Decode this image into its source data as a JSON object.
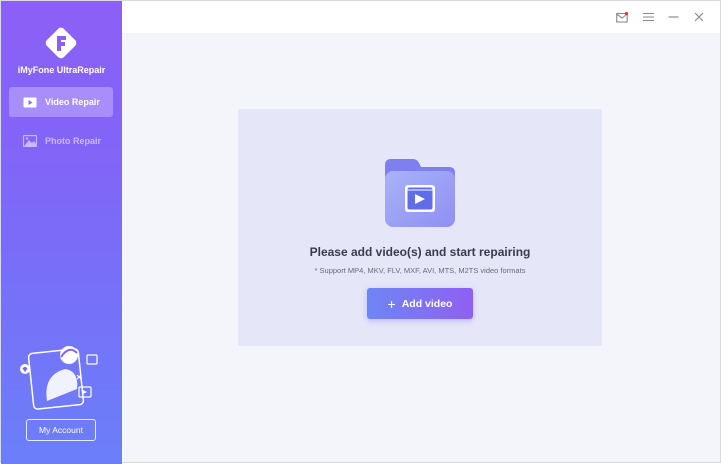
{
  "app": {
    "name": "iMyFone UltraRepair"
  },
  "sidebar": {
    "items": [
      {
        "label": "Video Repair",
        "icon": "video-icon",
        "active": true
      },
      {
        "label": "Photo Repair",
        "icon": "image-icon",
        "active": false
      }
    ],
    "account_label": "My Account"
  },
  "titlebar": {
    "icons": [
      "mail-icon",
      "menu-icon",
      "minimize-icon",
      "close-icon"
    ],
    "notification_color": "#e53935"
  },
  "main": {
    "title": "Please add video(s) and start repairing",
    "subtitle": "* Support MP4, MKV, FLV, MXF, AVI, MTS, M2TS video formats",
    "add_button_label": "Add video"
  },
  "colors": {
    "sidebar_top": "#8c5ff7",
    "sidebar_bottom": "#6b7ff9",
    "button_start": "#6e86f5",
    "button_end": "#8f60f2",
    "dropzone": "#e5e6f8"
  }
}
